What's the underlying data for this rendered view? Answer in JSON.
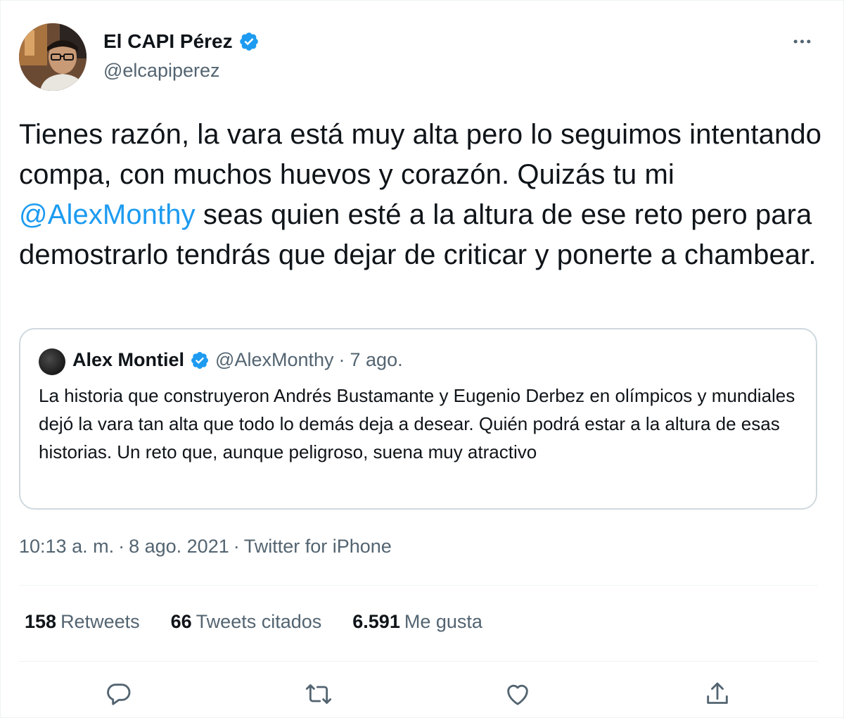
{
  "author": {
    "display_name": "El CAPI Pérez",
    "handle": "@elcapiperez",
    "verified": true
  },
  "tweet": {
    "text_parts": [
      "Tienes razón, la vara está muy alta pero lo seguimos intentando compa, con muchos huevos y corazón. Quizás tu mi ",
      "@AlexMonthy",
      " seas quien esté a la altura de ese reto pero para demostrarlo tendrás que dejar de criticar y ponerte a chambear."
    ]
  },
  "quoted": {
    "display_name": "Alex Montiel",
    "handle": "@AlexMonthy",
    "separator": "·",
    "date": "7 ago.",
    "text": "La historia que construyeron Andrés Bustamante y Eugenio Derbez en olímpicos y mundiales dejó la vara tan alta que todo lo demás deja a desear. Quién podrá estar a la altura de esas historias. Un reto que, aunque peligroso, suena muy atractivo"
  },
  "meta": {
    "time": "10:13 a. m.",
    "date": "8 ago. 2021",
    "source": "Twitter for iPhone",
    "separator": "·"
  },
  "stats": {
    "retweets_count": "158",
    "retweets_label": "Retweets",
    "quotes_count": "66",
    "quotes_label": "Tweets citados",
    "likes_count": "6.591",
    "likes_label": "Me gusta"
  },
  "colors": {
    "accent": "#1d9bf0",
    "text_primary": "#0f1419",
    "text_secondary": "#536471",
    "border": "#cfd9de"
  },
  "icons": {
    "more": "more-horizontal-icon",
    "verified": "verified-badge-icon",
    "reply": "reply-icon",
    "retweet": "retweet-icon",
    "like": "heart-icon",
    "share": "share-icon"
  }
}
